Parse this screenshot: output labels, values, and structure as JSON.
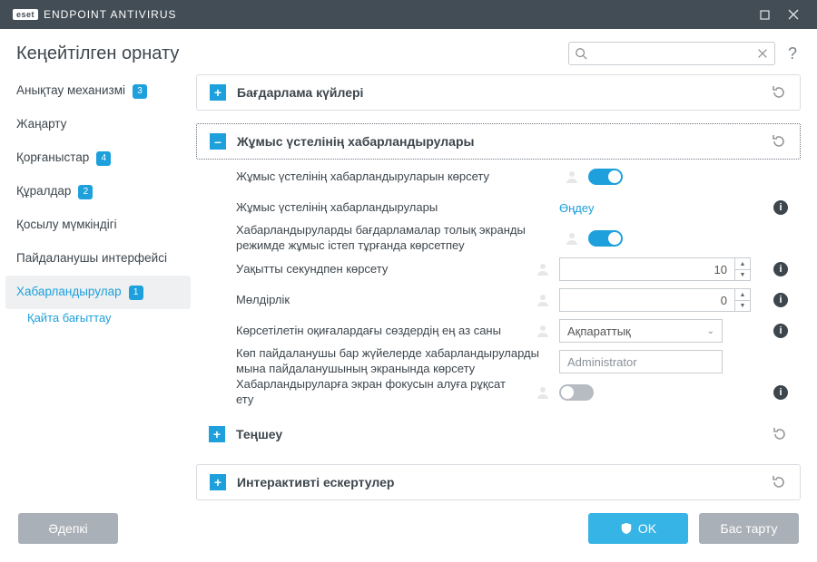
{
  "window": {
    "brand_box": "eset",
    "brand_name": "ENDPOINT ANTIVIRUS"
  },
  "header": {
    "title": "Кеңейтілген орнату",
    "search_placeholder": "",
    "help": "?"
  },
  "sidebar": {
    "items": [
      {
        "label": "Анықтау механизмі",
        "badge": "3"
      },
      {
        "label": "Жаңарту",
        "badge": ""
      },
      {
        "label": "Қорғаныстар",
        "badge": "4"
      },
      {
        "label": "Құралдар",
        "badge": "2"
      },
      {
        "label": "Қосылу мүмкіндігі",
        "badge": ""
      },
      {
        "label": "Пайдаланушы интерфейсі",
        "badge": ""
      },
      {
        "label": "Хабарландырулар",
        "badge": "1"
      }
    ],
    "sub": "Қайта бағыттау"
  },
  "panels": {
    "p0": {
      "title": "Бағдарлама күйлері"
    },
    "p1": {
      "title": "Жұмыс үстелінің хабарландырулары",
      "rows": {
        "show": {
          "label": "Жұмыс үстелінің хабарландыруларын көрсету"
        },
        "edit": {
          "label": "Жұмыс үстелінің хабарландырулары",
          "link": "Өңдеу"
        },
        "fullscreen": {
          "label": "Хабарландыруларды бағдарламалар толық экранды режимде жұмыс істеп тұрғанда көрсетпеу"
        },
        "seconds": {
          "label": "Уақытты секундпен көрсету",
          "value": "10"
        },
        "opacity": {
          "label": "Мөлдірлік",
          "value": "0"
        },
        "verbosity": {
          "label": "Көрсетілетін оқиғалардағы сөздердің ең аз саны",
          "value": "Ақпараттық"
        },
        "multiuser": {
          "label": "Көп пайдаланушы бар жүйелерде хабарландыруларды мына пайдаланушының экранында көрсету",
          "value": "Administrator"
        },
        "focus": {
          "label": "Хабарландыруларға экран фокусын алуға рұқсат ету"
        }
      }
    },
    "p2": {
      "title": "Теңшеу"
    },
    "p3": {
      "title": "Интерактивті ескертулер"
    }
  },
  "footer": {
    "default": "Әдепкі",
    "ok": "OK",
    "cancel": "Бас тарту"
  }
}
